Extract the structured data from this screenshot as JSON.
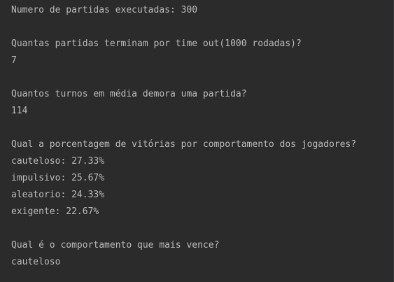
{
  "console": {
    "lines": [
      "Numero de partidas executadas: 300",
      "",
      "Quantas partidas terminam por time out(1000 rodadas)?",
      "7",
      "",
      "Quantos turnos em média demora uma partida?",
      "114",
      "",
      "Qual a porcentagem de vitórias por comportamento dos jogadores?",
      "cauteloso: 27.33%",
      "impulsivo: 25.67%",
      "aleatorio: 24.33%",
      "exigente: 22.67%",
      "",
      "Qual é o comportamento que mais vence?",
      "cauteloso"
    ],
    "text_color": "#bbbbbb",
    "background_color": "#2b2b2b"
  }
}
